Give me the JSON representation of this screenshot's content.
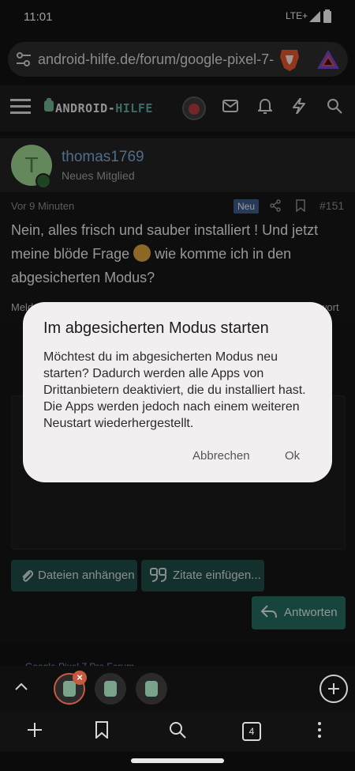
{
  "status_bar": {
    "time": "11:01",
    "network": "LTE+"
  },
  "browser": {
    "url": "android-hilfe.de/forum/google-pixel-7-",
    "tab_count": "4"
  },
  "site": {
    "logo_main": "ANDROID-",
    "logo_highlight": "HILFE"
  },
  "post": {
    "author": "thomas1769",
    "avatar_letter": "T",
    "rank": "Neues Mitglied",
    "time": "Vor 9 Minuten",
    "badge": "Neu",
    "number": "#151",
    "text_before_emoji": "Nein, alles frisch und sauber installiert ! Und jetzt meine blöde Frage ",
    "text_after_emoji": " wie komme ich in den abgesicherten Modus?",
    "footer_left": "Meld",
    "footer_right": "wort"
  },
  "editor": {
    "attach_label": "Dateien anhängen",
    "quote_label": "Zitate einfügen...",
    "reply_label": "Antworten",
    "forum_link": "Google Pixel 7 Pro Forum"
  },
  "dialog": {
    "title": "Im abgesicherten Modus starten",
    "body": "Möchtest du im abgesicherten Modus neu starten? Dadurch werden alle Apps von Drittanbietern deaktiviert, die du installiert hast. Die Apps werden jedoch nach einem weiteren Neustart wiederhergestellt.",
    "cancel_label": "Abbrechen",
    "ok_label": "Ok"
  },
  "colors": {
    "accent_teal": "#246a5e",
    "dialog_bg": "#f2eff1",
    "username": "#7ba6d3",
    "tab_active": "#c65a3e"
  },
  "icons": [
    "settings-sliders-icon",
    "brave-lion-icon",
    "brave-rewards-icon",
    "menu-icon",
    "mail-icon",
    "bell-icon",
    "bolt-icon",
    "search-icon",
    "share-icon",
    "bookmark-icon",
    "paperclip-icon",
    "quote-icon",
    "reply-icon",
    "chevron-up-icon",
    "plus-icon",
    "tabs-icon",
    "more-icon"
  ]
}
